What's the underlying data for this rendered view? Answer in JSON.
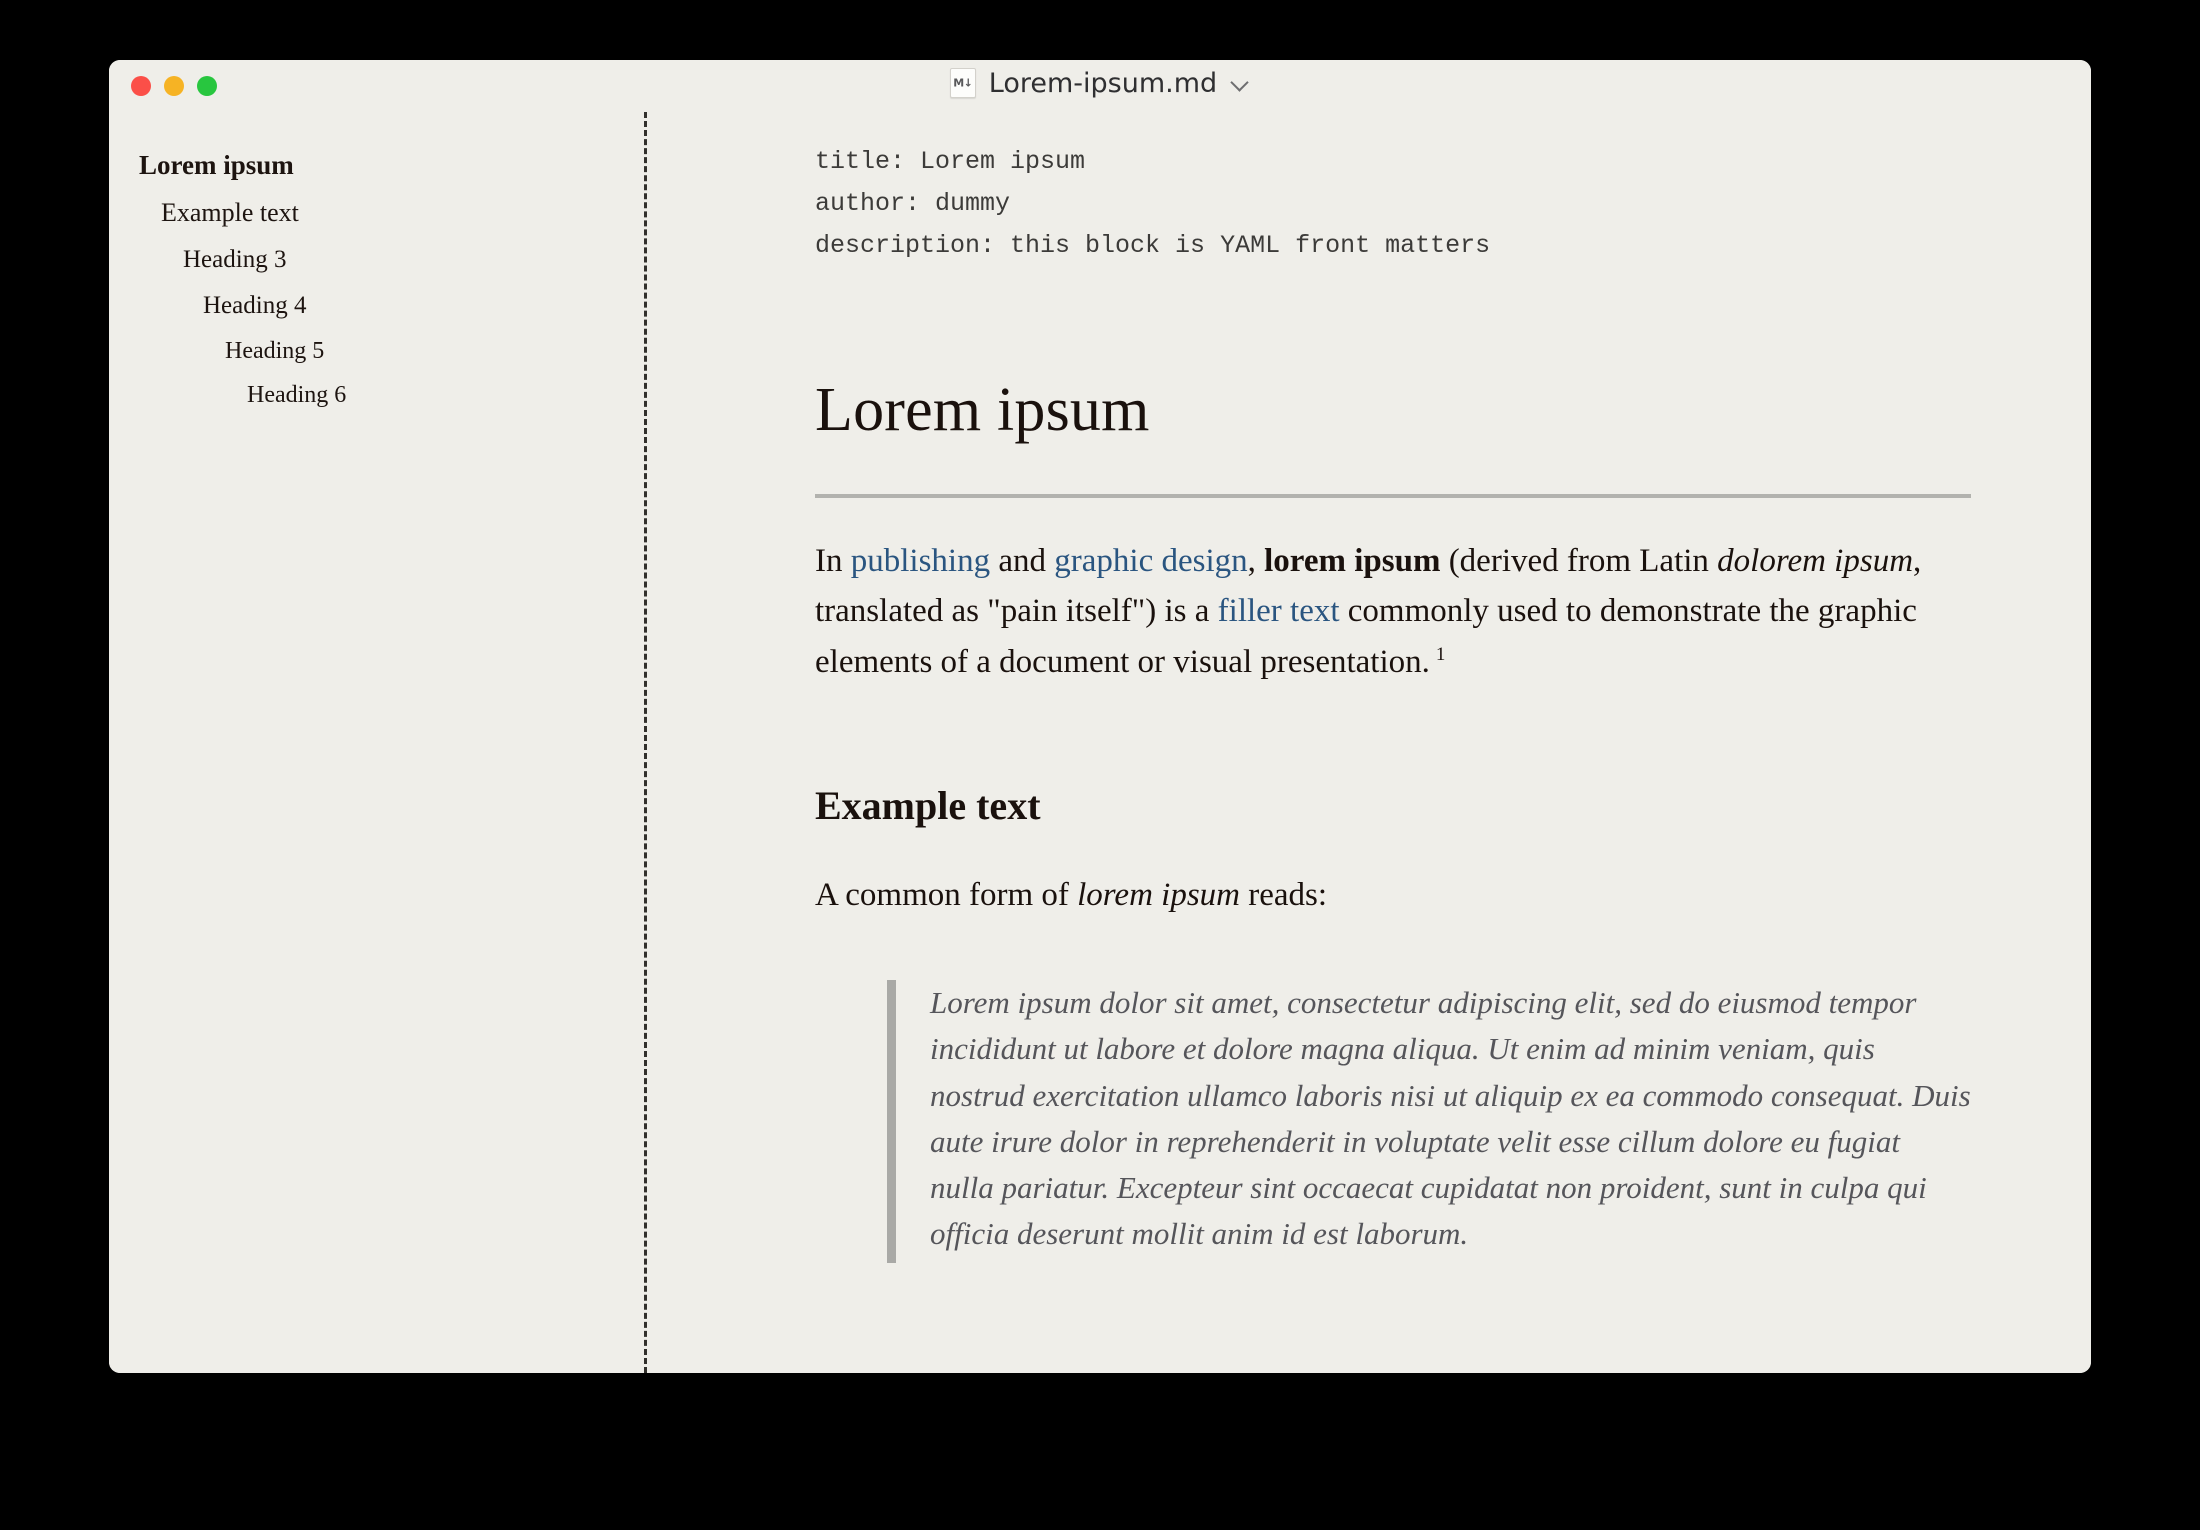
{
  "window": {
    "background_color": "#efeee9",
    "desktop_color": "#000000",
    "traffic_lights": [
      {
        "name": "close",
        "color": "#fb4f48"
      },
      {
        "name": "minimize",
        "color": "#f6b324"
      },
      {
        "name": "maximize",
        "color": "#28c63f"
      }
    ]
  },
  "titlebar": {
    "file_icon": "markdown-file-icon",
    "file_icon_glyph": "M↓",
    "filename": "Lorem-ipsum.md",
    "chevron": "chevron-down-icon"
  },
  "sidebar": {
    "outline": [
      {
        "label": "Lorem ipsum",
        "level": 1
      },
      {
        "label": "Example text",
        "level": 2
      },
      {
        "label": "Heading 3",
        "level": 3
      },
      {
        "label": "Heading 4",
        "level": 4
      },
      {
        "label": "Heading 5",
        "level": 5
      },
      {
        "label": "Heading 6",
        "level": 6
      }
    ]
  },
  "content": {
    "frontmatter": "title: Lorem ipsum\nauthor: dummy\ndescription: this block is YAML front matters",
    "frontmatter_fields": [
      {
        "key": "title",
        "value": "Lorem ipsum"
      },
      {
        "key": "author",
        "value": "dummy"
      },
      {
        "key": "description",
        "value": "this block is YAML front matters"
      }
    ],
    "h1": "Lorem ipsum",
    "paragraph_1": {
      "seg_in": "In ",
      "link_publishing": "publishing",
      "seg_and": " and ",
      "link_graphic_design": "graphic design",
      "seg_comma": ", ",
      "bold_lorem_ipsum": "lorem ipsum",
      "seg_derived": " (derived from Latin ",
      "italic_dolorem": "dolorem ipsum",
      "seg_translated": ", translated as \"pain itself\") is a ",
      "link_filler_text": "filler text",
      "seg_tail": " commonly used to demonstrate the graphic elements of a document or visual presentation.",
      "footnote_marker": "1"
    },
    "h2": "Example text",
    "paragraph_2": {
      "seg_lead": "A common form of ",
      "italic_lorem_ipsum": "lorem ipsum",
      "seg_tail": " reads:"
    },
    "blockquote": "Lorem ipsum dolor sit amet, consectetur adipiscing elit, sed do eiusmod tempor incididunt ut labore et dolore magna aliqua. Ut enim ad minim veniam, quis nostrud exercitation ullamco laboris nisi ut aliquip ex ea commodo consequat. Duis aute irure dolor in reprehenderit in voluptate velit esse cillum dolore eu fugiat nulla pariatur. Excepteur sint occaecat cupidatat non proident, sunt in culpa qui officia deserunt mollit anim id est laborum."
  },
  "colors": {
    "link": "#2a5580",
    "text": "#1a110d",
    "quote_text": "#55555a",
    "quote_bar": "#a9a9a6",
    "rule": "#b2b2ae",
    "divider": "#32302c"
  }
}
